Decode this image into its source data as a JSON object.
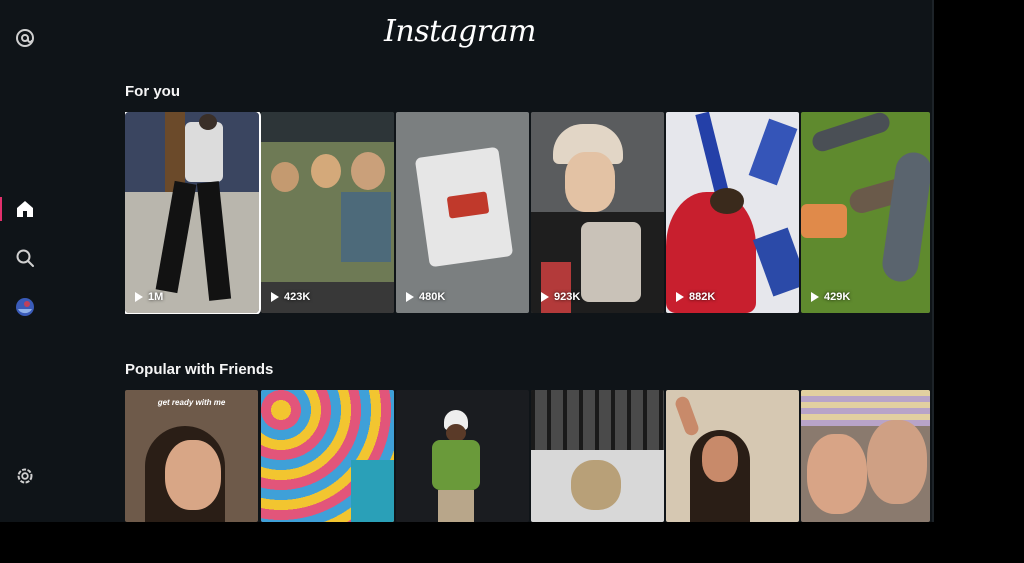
{
  "app": {
    "logo_text": "Instagram"
  },
  "sidebar": {
    "items": [
      {
        "name": "threads-icon"
      },
      {
        "name": "home-icon",
        "active": true
      },
      {
        "name": "search-icon"
      },
      {
        "name": "profile-avatar-icon"
      },
      {
        "name": "settings-icon"
      }
    ]
  },
  "sections": [
    {
      "title": "For you",
      "tiles": [
        {
          "views": "1M",
          "selected": true
        },
        {
          "views": "423K"
        },
        {
          "views": "480K"
        },
        {
          "views": "923K"
        },
        {
          "views": "882K"
        },
        {
          "views": "429K"
        }
      ]
    },
    {
      "title": "Popular with Friends",
      "tiles": [
        {
          "caption": "get ready with me"
        },
        {},
        {},
        {},
        {},
        {}
      ]
    }
  ],
  "colors": {
    "background": "#0f1418",
    "accent": "#e1306c"
  }
}
